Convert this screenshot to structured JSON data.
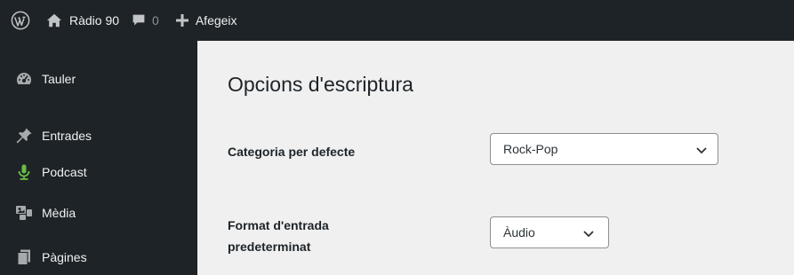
{
  "adminbar": {
    "site_name": "Ràdio 90",
    "comments_count": "0",
    "new_label": "Afegeix"
  },
  "sidebar": {
    "items": [
      {
        "label": "Tauler",
        "icon": "dashboard-icon"
      },
      {
        "label": "Entrades",
        "icon": "pin-icon"
      },
      {
        "label": "Podcast",
        "icon": "microphone-icon",
        "color": "#6bbd45"
      },
      {
        "label": "Mèdia",
        "icon": "media-icon"
      },
      {
        "label": "Pàgines",
        "icon": "pages-icon"
      }
    ]
  },
  "main": {
    "title": "Opcions d'escriptura",
    "default_category": {
      "label": "Categoria per defecte",
      "value": "Rock-Pop"
    },
    "default_format": {
      "label_line1": "Format d'entrada",
      "label_line2": "predeterminat",
      "value": "Àudio"
    }
  },
  "colors": {
    "adminbar_bg": "#1d2327",
    "sidebar_bg": "#1d2327",
    "content_bg": "#f0f0f1",
    "podcast_icon": "#6bbd45"
  }
}
